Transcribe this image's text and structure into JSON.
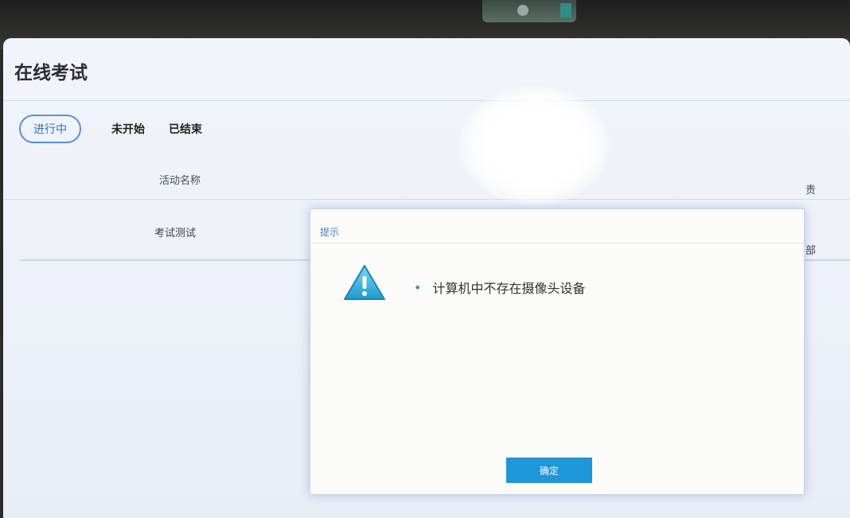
{
  "page": {
    "title": "在线考试"
  },
  "tabs": [
    {
      "label": "进行中",
      "active": true
    },
    {
      "label": "未开始",
      "active": false
    },
    {
      "label": "已结束",
      "active": false
    }
  ],
  "table": {
    "header": {
      "name": "活动名称",
      "right_partial": "责"
    },
    "rows": [
      {
        "name": "考试测试",
        "right_partial": "部"
      }
    ]
  },
  "dialog": {
    "title": "提示",
    "message": "计算机中不存在摄像头设备",
    "bullet": "•",
    "ok_label": "确定",
    "icon": "warning-icon"
  },
  "colors": {
    "accent": "#1f96d8",
    "tab_active": "#2f75c6",
    "dialog_title": "#4a78c4"
  }
}
